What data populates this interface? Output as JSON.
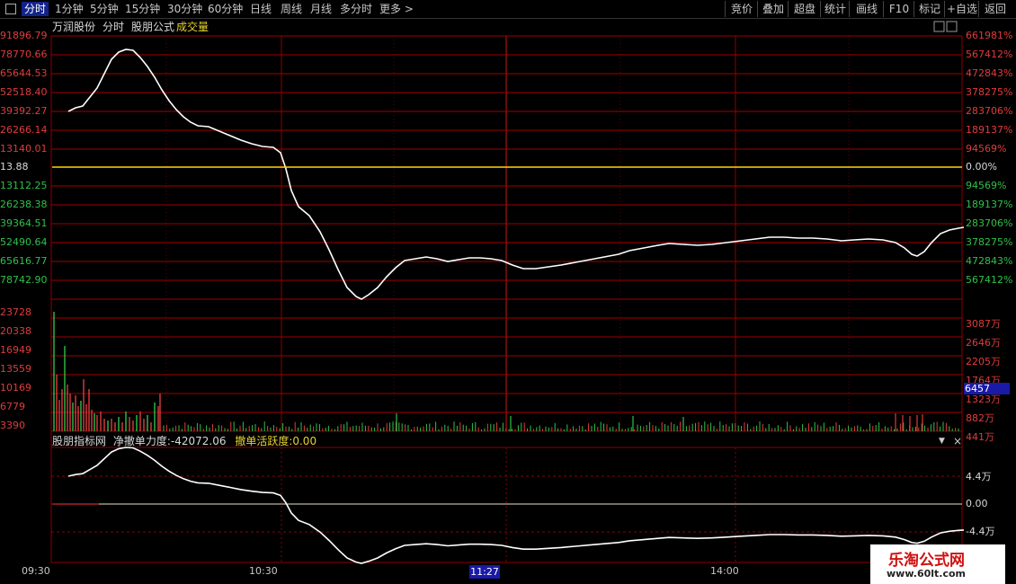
{
  "tabs": [
    "分时",
    "1分钟",
    "5分钟",
    "15分钟",
    "30分钟",
    "60分钟",
    "日线",
    "周线",
    "月线",
    "多分时",
    "更多 >"
  ],
  "right_buttons": [
    "竞价",
    "叠加",
    "超盘",
    "统计",
    "画线",
    "F10",
    "标记",
    "+自选",
    "返回"
  ],
  "stock_name": "万润股份",
  "sub_labels": {
    "period": "分时",
    "formula": "股朋公式",
    "volume": "成交量"
  },
  "price_axis_left": [
    "91896.79",
    "78770.66",
    "65644.53",
    "52518.40",
    "39392.27",
    "26266.14",
    "13140.01",
    "13.88",
    "13112.25",
    "26238.38",
    "39364.51",
    "52490.64",
    "65616.77",
    "78742.90"
  ],
  "price_axis_right": [
    "661981%",
    "567412%",
    "472843%",
    "378275%",
    "283706%",
    "189137%",
    "94569%",
    "0.00%",
    "94569%",
    "189137%",
    "283706%",
    "378275%",
    "472843%",
    "567412%"
  ],
  "volume_axis_left": [
    "23728",
    "20338",
    "16949",
    "13559",
    "10169",
    "6779",
    "3390"
  ],
  "volume_axis_right": [
    "3087万",
    "2646万",
    "2205万",
    "1764万",
    "1323万",
    "882万",
    "441万"
  ],
  "current_volume": "6457",
  "indicator": {
    "name": "股朋指标网",
    "label1": "净撤单力度:",
    "value1": "-42072.06",
    "label2": "撤单活跃度:",
    "value2": "0.00"
  },
  "indicator_axis_right": [
    "4.4万",
    "0.00",
    "-4.4万"
  ],
  "time_axis": [
    "09:30",
    "10:30",
    "14:00"
  ],
  "cursor_time": "11:27",
  "watermark": {
    "title": "乐淘公式网",
    "url": "www.60lt.com"
  },
  "colors": {
    "accent": "#13238a",
    "grid": "#8b0000",
    "price_line": "#ffffff",
    "baseline": "#ffd700",
    "up": "#e03c3c",
    "down": "#2ec14a"
  }
}
